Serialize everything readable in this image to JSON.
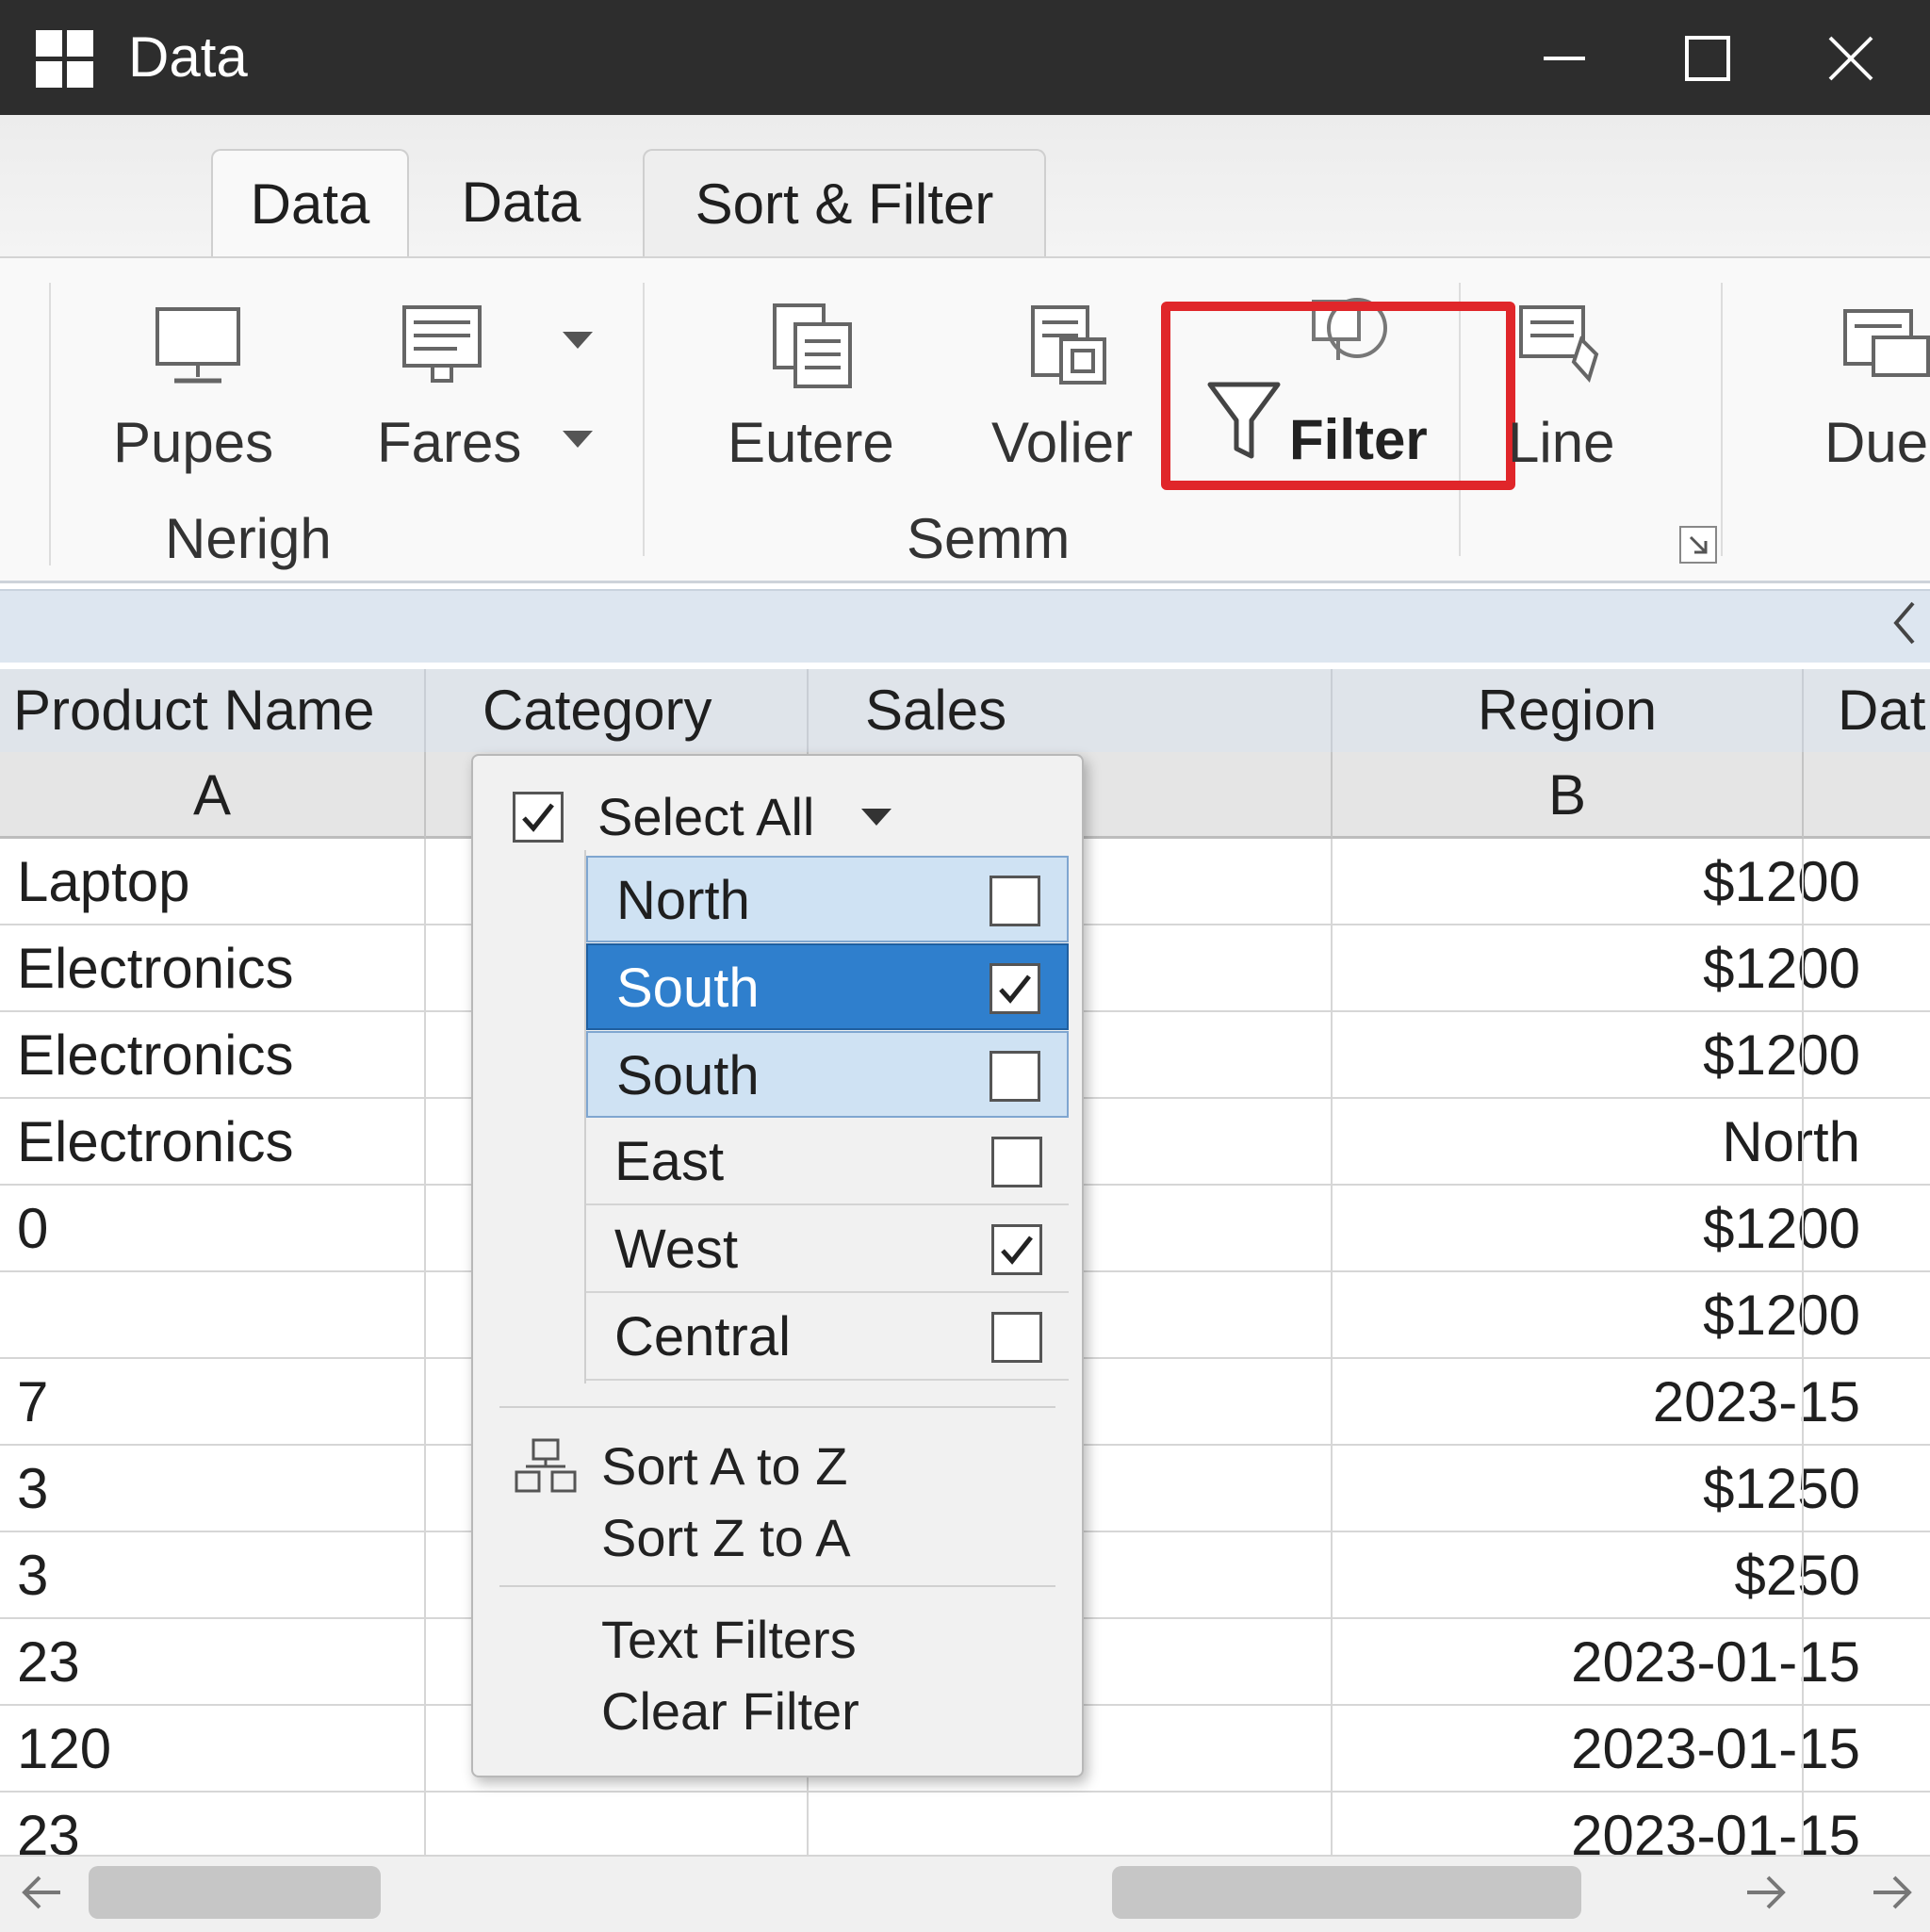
{
  "window": {
    "title": "Data"
  },
  "ribbon": {
    "tabs": [
      {
        "label": "Data",
        "active": true
      },
      {
        "label": "Data",
        "active": false
      },
      {
        "label": "Sort & Filter",
        "active": false
      }
    ],
    "groups": [
      {
        "label": "Nerigh",
        "buttons": [
          {
            "label": "Pupes",
            "icon": "monitor-icon"
          },
          {
            "label": "Fares",
            "icon": "document-list-icon"
          }
        ]
      },
      {
        "label": "Semm",
        "buttons": [
          {
            "label": "Eutere",
            "icon": "copy-documents-icon"
          },
          {
            "label": "Volier",
            "icon": "data-grid-icon"
          },
          {
            "label": "Filter",
            "icon": "funnel-icon"
          },
          {
            "label": "Line",
            "icon": "list-edit-icon"
          }
        ]
      },
      {
        "label": "",
        "buttons": [
          {
            "label": "Due",
            "icon": "table-icon"
          }
        ]
      }
    ]
  },
  "grid": {
    "headers": [
      "Product Name",
      "Category",
      "Sales",
      "Region",
      "Dat"
    ],
    "column_letters": [
      "A",
      "",
      "",
      "B",
      ""
    ],
    "rows": [
      {
        "a": "Laptop",
        "b": "$1200"
      },
      {
        "a": "Electronics",
        "b": "$1200"
      },
      {
        "a": "Electronics",
        "b": "$1200"
      },
      {
        "a": "Electronics",
        "b": "North"
      },
      {
        "a": "0",
        "b": "$1200"
      },
      {
        "a": "",
        "b": "$1200"
      },
      {
        "a": "7",
        "b": "2023-15"
      },
      {
        "a": "3",
        "b": "$1250"
      },
      {
        "a": "3",
        "b": "$250"
      },
      {
        "a": "23",
        "b": "2023-01-15"
      },
      {
        "a": "120",
        "b": "2023-01-15"
      },
      {
        "a": "23",
        "b": "2023-01-15"
      }
    ]
  },
  "dropdown": {
    "select_all": {
      "label": "Select All",
      "checked": true
    },
    "items": [
      {
        "label": "North",
        "checked": false,
        "state": "hover"
      },
      {
        "label": "South",
        "checked": true,
        "state": "selected"
      },
      {
        "label": "South",
        "checked": false,
        "state": "hover"
      },
      {
        "label": "East",
        "checked": false,
        "state": "normal"
      },
      {
        "label": "West",
        "checked": true,
        "state": "normal"
      },
      {
        "label": "Central",
        "checked": false,
        "state": "normal"
      }
    ],
    "menu": {
      "sort_az": "Sort A to Z",
      "sort_za": "Sort Z to A",
      "text_filters": "Text Filters",
      "clear_filter": "Clear Filter"
    }
  },
  "colors": {
    "titlebar": "#2d2d2d",
    "highlight_red": "#e0262a",
    "selected_blue": "#2f7fcd",
    "hover_blue": "#cfe2f3"
  }
}
